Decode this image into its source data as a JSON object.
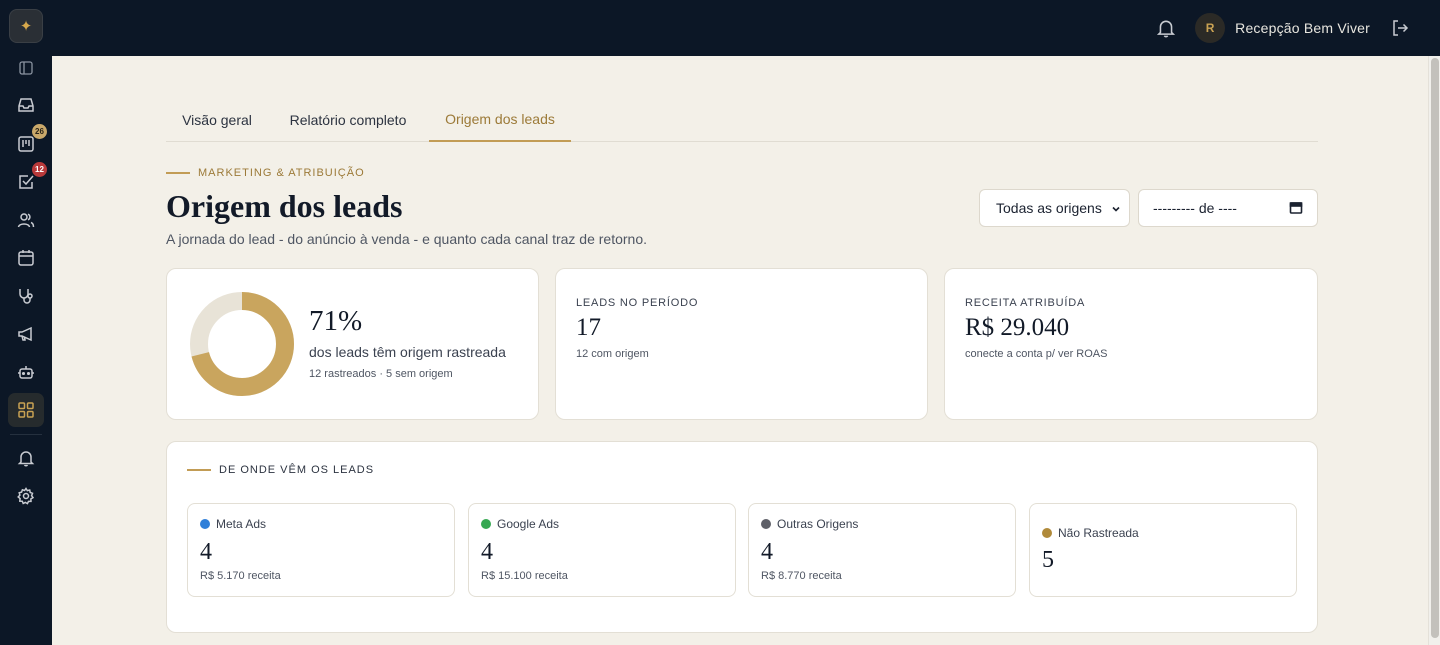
{
  "app": {
    "logo_symbol": "✦"
  },
  "topbar": {
    "user_initial": "R",
    "user_name": "Recepção Bem Viver",
    "icons": [
      "bell-icon",
      "logout-icon"
    ]
  },
  "sidebar": {
    "items": [
      {
        "name": "sidebar-toggle",
        "icon": "panel-icon"
      },
      {
        "name": "inbox",
        "icon": "inbox-icon"
      },
      {
        "name": "kanban",
        "icon": "kanban-icon",
        "badge": "26"
      },
      {
        "name": "tasks",
        "icon": "checkbox-icon",
        "badge": "12"
      },
      {
        "name": "contacts",
        "icon": "users-icon"
      },
      {
        "name": "calendar",
        "icon": "calendar-icon"
      },
      {
        "name": "clinical",
        "icon": "stethoscope-icon"
      },
      {
        "name": "marketing",
        "icon": "megaphone-icon"
      },
      {
        "name": "automation",
        "icon": "bot-icon"
      },
      {
        "name": "dashboards",
        "icon": "grid-icon",
        "active": true
      },
      {
        "name": "notifications",
        "icon": "bell-icon"
      },
      {
        "name": "settings",
        "icon": "gear-icon"
      }
    ]
  },
  "tabs": [
    {
      "label": "Visão geral"
    },
    {
      "label": "Relatório completo"
    },
    {
      "label": "Origem dos leads",
      "active": true
    }
  ],
  "header": {
    "eyebrow": "MARKETING & ATRIBUIÇÃO",
    "title": "Origem dos leads",
    "subtitle": "A jornada do lead - do anúncio à venda - e quanto cada canal traz de retorno."
  },
  "filters": {
    "origin_select": "Todas as origens",
    "date_value": "--------- de ----"
  },
  "tracking_card": {
    "percent": "71%",
    "percent_value": 71,
    "label": "dos leads têm origem rastreada",
    "detail": "12 rastreados · 5 sem origem",
    "colors": {
      "tracked": "#c9a55e",
      "untracked": "#e8e3d7"
    }
  },
  "leads_card": {
    "label": "LEADS NO PERÍODO",
    "value": "17",
    "sub": "12 com origem"
  },
  "revenue_card": {
    "label": "RECEITA ATRIBUÍDA",
    "value": "R$ 29.040",
    "sub": "conecte a conta p/ ver ROAS"
  },
  "sources": {
    "eyebrow": "DE ONDE VÊM OS LEADS",
    "items": [
      {
        "name": "Meta Ads",
        "color": "#2f7fd9",
        "value": "4",
        "revenue": "R$ 5.170 receita"
      },
      {
        "name": "Google Ads",
        "color": "#36a852",
        "value": "4",
        "revenue": "R$ 15.100 receita"
      },
      {
        "name": "Outras Origens",
        "color": "#5e6068",
        "value": "4",
        "revenue": "R$ 8.770 receita"
      },
      {
        "name": "Não Rastreada",
        "color": "#b08a3a",
        "value": "5",
        "revenue": ""
      }
    ]
  }
}
